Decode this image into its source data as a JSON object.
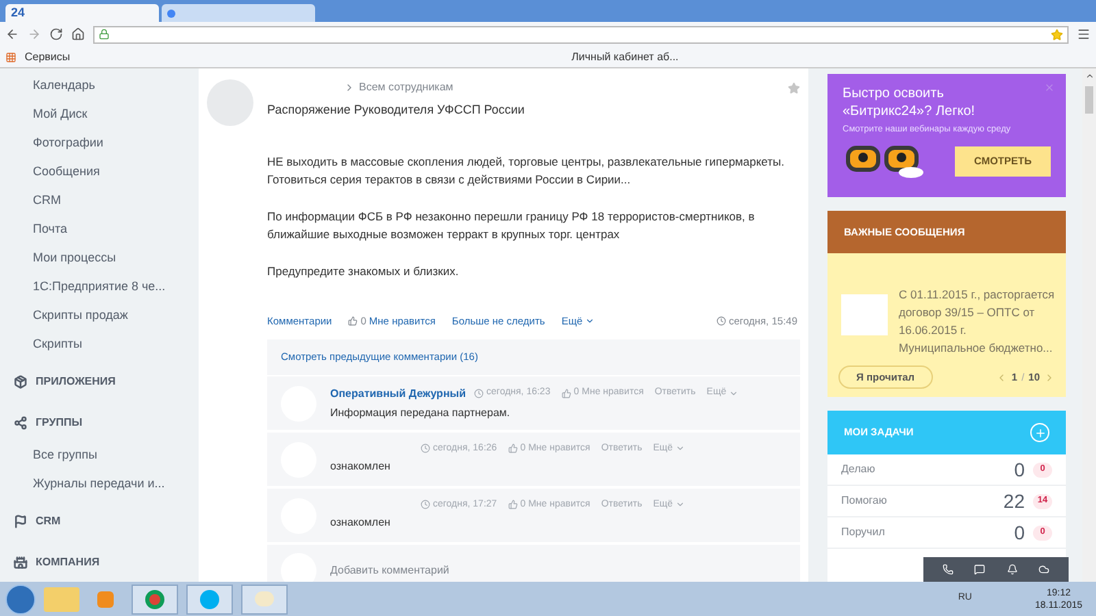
{
  "browser": {
    "tabs": [
      {
        "title": "24",
        "selected": true
      },
      {
        "selected": false
      }
    ],
    "bookmarks": [
      "Сервисы",
      "Личный кабинет аб..."
    ]
  },
  "sidebar": {
    "items": [
      {
        "kind": "item",
        "label": "Календарь"
      },
      {
        "kind": "item",
        "label": "Мой Диск"
      },
      {
        "kind": "item",
        "label": "Фотографии"
      },
      {
        "kind": "item",
        "label": "Сообщения"
      },
      {
        "kind": "item",
        "label": "CRM"
      },
      {
        "kind": "item",
        "label": "Почта"
      },
      {
        "kind": "item",
        "label": "Мои процессы"
      },
      {
        "kind": "item",
        "label": "1С:Предприятие 8 че..."
      },
      {
        "kind": "item",
        "label": "Скрипты продаж"
      },
      {
        "kind": "item",
        "label": "Скрипты"
      },
      {
        "kind": "section",
        "label": "ПРИЛОЖЕНИЯ"
      },
      {
        "kind": "section",
        "label": "ГРУППЫ"
      },
      {
        "kind": "item",
        "label": "Все группы"
      },
      {
        "kind": "item",
        "label": "Журналы передачи и..."
      },
      {
        "kind": "section",
        "label": "CRM"
      },
      {
        "kind": "section",
        "label": "КОМПАНИЯ"
      }
    ]
  },
  "post": {
    "recipient": "Всем сотрудникам",
    "title": "Распоряжение Руководителя УФССП России",
    "paragraphs": [
      "НЕ выходить в массовые скопления людей, торговые центры, развлекательные гипермаркеты. Готовиться серия терактов в связи с действиями России в Сирии...",
      "По информации ФСБ в РФ незаконно перешли границу РФ 18 террористов-смертников, в ближайшие выходные возможен терракт в крупных торг. центрах",
      "Предупредите знакомых и близких."
    ],
    "actions": {
      "comments": "Комментарии",
      "likes": "0",
      "like": "Мне нравится",
      "unfollow": "Больше не следить",
      "more": "Ещё",
      "time": "сегодня, 15:49"
    },
    "previous_comments": "Смотреть предыдущие комментарии (16)",
    "comments": [
      {
        "author": "Оперативный Дежурный",
        "time": "сегодня, 16:23",
        "likes": "0",
        "like": "Мне нравится",
        "reply": "Ответить",
        "more": "Ещё",
        "text": "Информация передана партнерам."
      },
      {
        "time": "сегодня, 16:26",
        "likes": "0",
        "like": "Мне нравится",
        "reply": "Ответить",
        "more": "Ещё",
        "text": "ознакомлен"
      },
      {
        "time": "сегодня, 17:27",
        "likes": "0",
        "like": "Мне нравится",
        "reply": "Ответить",
        "more": "Ещё",
        "text": "ознакомлен"
      }
    ],
    "add_comment": {
      "placeholder": "Добавить комментарий"
    }
  },
  "promo": {
    "title": "Быстро освоить «Битрикс24»? Легко!",
    "subtitle": "Смотрите наши вебинары каждую среду",
    "button": "СМОТРЕТЬ"
  },
  "important": {
    "header": "ВАЖНЫЕ СООБЩЕНИЯ",
    "text": "С 01.11.2015 г., расторгается договор 39/15 – ОПТС от 16.06.2015 г. Муниципальное бюджетно...",
    "button": "Я прочитал",
    "page": "1",
    "separator": "/",
    "total": "10"
  },
  "tasks": {
    "header": "МОИ ЗАДАЧИ",
    "rows": [
      {
        "label": "Делаю",
        "count": "0",
        "badge": "0"
      },
      {
        "label": "Помогаю",
        "count": "22",
        "badge": "14"
      },
      {
        "label": "Поручил",
        "count": "0",
        "badge": "0"
      }
    ]
  },
  "taskbar": {
    "language": "RU",
    "time": "19:12",
    "date": "18.11.2015"
  }
}
